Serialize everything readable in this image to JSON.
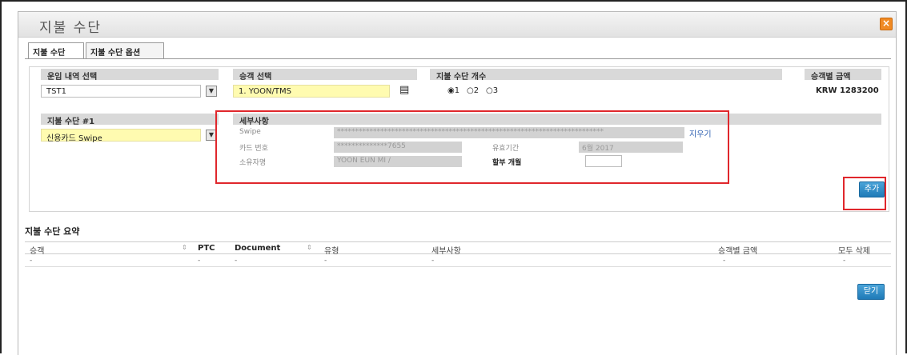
{
  "dialog": {
    "title": "지불 수단",
    "close_icon": "close-icon",
    "close_glyph": "×"
  },
  "tabs": [
    {
      "label": "지불 수단",
      "active": true
    },
    {
      "label": "지불 수단 옵션",
      "active": false
    }
  ],
  "form": {
    "itinerary": {
      "header": "운임 내역 선택",
      "value": "TST1"
    },
    "passenger": {
      "header": "승객 선택",
      "value": "1. YOON/TMS"
    },
    "payment_count": {
      "header": "지불 수단 개수",
      "options": [
        "1",
        "2",
        "3"
      ],
      "selected": "1"
    },
    "amount_per_passenger": {
      "header": "승객별 금액",
      "value": "KRW 1283200"
    },
    "payment_method": {
      "header": "지불 수단 #1",
      "value": "신용카드 Swipe"
    },
    "details": {
      "header": "세부사항",
      "swipe_label": "Swipe",
      "swipe_value": "**************************************************************************",
      "clear_link": "지우기",
      "card_number_label": "카드 번호",
      "card_number_value": "**************7655",
      "expiry_label": "유효기간",
      "expiry_value": "6월 2017",
      "holder_label": "소유자명",
      "holder_value": "YOON EUN MI      /",
      "installment_label": "할부 개월",
      "installment_value": ""
    },
    "add_button": "추가"
  },
  "summary": {
    "title": "지불 수단 요약",
    "columns": [
      "승객",
      "PTC",
      "Document",
      "유형",
      "세부사항",
      "승객별 금액",
      "모두 삭제"
    ],
    "row": [
      "-",
      "-",
      "-",
      "-",
      "-",
      "-",
      "-"
    ],
    "close_button": "닫기"
  },
  "colors": {
    "highlight_red": "#e0272c",
    "field_yellow": "#fffbb0",
    "button_blue": "#1f7bb8",
    "close_orange": "#f08a24"
  }
}
